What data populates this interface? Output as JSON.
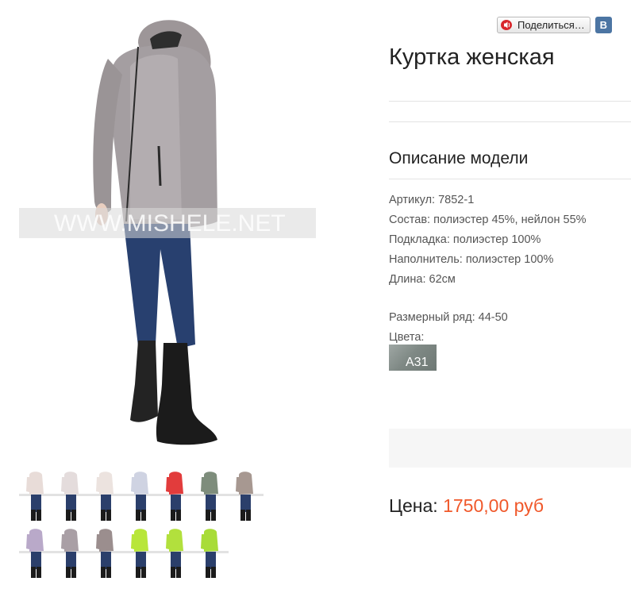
{
  "share": {
    "label": "Поделиться…",
    "vk_label": "В",
    "icon": "speaker-icon",
    "vk_color": "#4c75a3"
  },
  "product": {
    "title": "Куртка женская",
    "description_title": "Описание модели",
    "specs": [
      "Артикул: 7852-1",
      "Состав: полиэстер 45%, нейлон 55%",
      "Подкладка: полиэстер 100%",
      "Наполнитель: полиэстер 100%",
      "Длина: 62см"
    ],
    "sizes": "Размерный ряд: 44-50",
    "colors_label": "Цвета:",
    "swatch_code": "A31",
    "price_label": "Цена:",
    "price_value": "1750,00 руб",
    "price_color": "#f0582a"
  },
  "photo": {
    "watermark": "WWW.MISHELE.NET",
    "thumbnail_colors": [
      "#e8dcd8",
      "#e4dcdc",
      "#ece3df",
      "#cfd3e2",
      "#e23c3c",
      "#7e8d7c",
      "#a79891",
      "#b9a9c9",
      "#a99fa5",
      "#9b8e8e",
      "#b8e63a",
      "#b2e03d",
      "#a8dc38"
    ]
  }
}
